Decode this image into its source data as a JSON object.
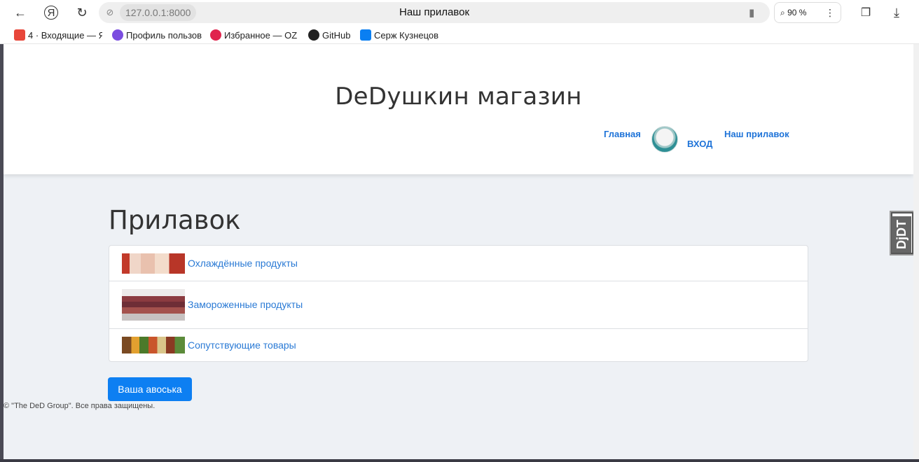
{
  "browser": {
    "url": "127.0.0.1:8000",
    "tab_title": "Наш прилавок",
    "zoom": "90 %",
    "back_icon": "←",
    "yandex_icon": "Я",
    "reload_icon": "↻",
    "site_icon": "⊘",
    "bookmark_icon": "▮",
    "zoom_icon": "⌕",
    "menu_icon": "⋮",
    "collections_icon": "❐",
    "download_icon": "⤓"
  },
  "bookmarks": [
    {
      "label": "4 · Входящие — Я",
      "color": "#e8463a"
    },
    {
      "label": "Профиль пользов",
      "color": "#7b4de0"
    },
    {
      "label": "Избранное — OZO",
      "color": "#e0244d"
    },
    {
      "label": "GitHub",
      "color": "#222222"
    },
    {
      "label": "Серж Кузнецов",
      "color": "#0a7ff2"
    }
  ],
  "site": {
    "title": "DeDушкин магазин",
    "nav": {
      "home": "Главная",
      "login": "ВХОД",
      "counter": "Наш прилавок"
    }
  },
  "page": {
    "heading": "Прилавок",
    "categories": [
      {
        "label": "Охлаждённые продукты"
      },
      {
        "label": "Замороженные продукты"
      },
      {
        "label": "Сопутствующие товары"
      }
    ],
    "cart_button": "Ваша авоська",
    "footer": "© \"The DeD Group\". Все права защищены."
  },
  "badge": {
    "text": "DjDT"
  },
  "colors": {
    "link": "#2a7ad5",
    "primary_button": "#0d7ff2",
    "page_bg": "#eef1f5"
  }
}
